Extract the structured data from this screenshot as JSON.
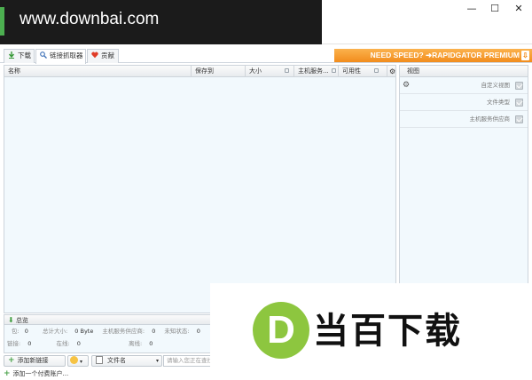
{
  "window": {
    "minimize": "—",
    "maximize": "☐",
    "close": "✕"
  },
  "watermark": {
    "url": "www.downbai.com"
  },
  "tabs": [
    {
      "label": "下载"
    },
    {
      "label": "链接抓取器"
    },
    {
      "label": "贡献"
    }
  ],
  "promo": {
    "text": "NEED SPEED? ➜RAPIDGATOR PREMIUM",
    "arrow": "⇩"
  },
  "table": {
    "columns": [
      "名称",
      "保存到",
      "大小",
      "主机服务...",
      "可用性"
    ]
  },
  "right_panel": {
    "header": "视图",
    "options": [
      {
        "label": "自定义视图",
        "checked": true
      },
      {
        "label": "文件类型",
        "checked": true
      },
      {
        "label": "主机服务供应商",
        "checked": true
      }
    ]
  },
  "summary": {
    "title": "总览",
    "row1": [
      {
        "label": "包:",
        "value": "0"
      },
      {
        "label": "总计大小:",
        "value": "0 Byte"
      },
      {
        "label": "主机服务供应商:",
        "value": "0"
      },
      {
        "label": "未知状态:",
        "value": "0"
      }
    ],
    "row2": [
      {
        "label": "链接:",
        "value": "0"
      },
      {
        "label": "在线:",
        "value": "0"
      },
      {
        "label": "离线:",
        "value": "0"
      }
    ]
  },
  "bottom": {
    "add_link": "添加新链接",
    "filter_label": "文件名",
    "search_placeholder": "请输入您正在查找",
    "add_account": "添加一个付费账户..."
  },
  "logo": {
    "letter": "D",
    "text": "当百下载",
    "color": "#8dc63f"
  }
}
